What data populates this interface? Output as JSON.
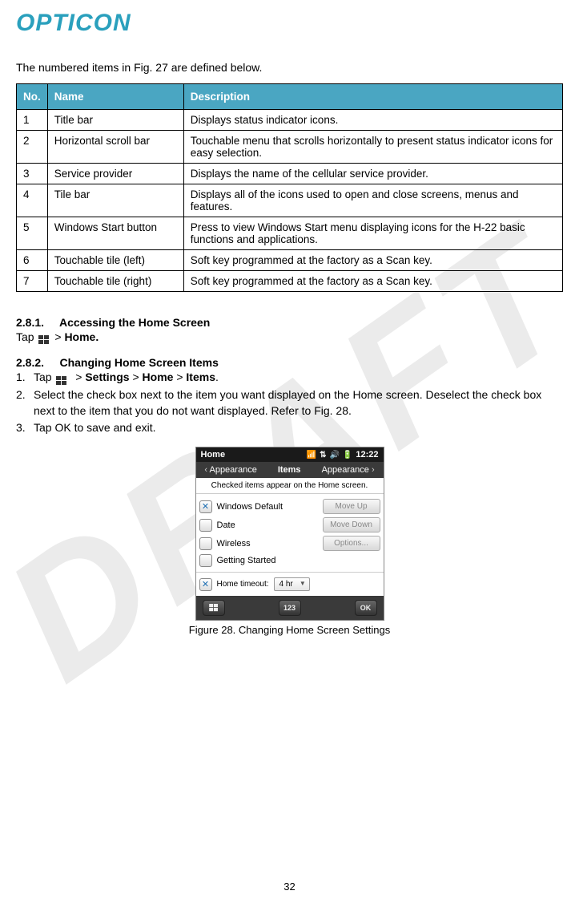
{
  "logo_text": "OPTICON",
  "watermark": "DRAFT",
  "intro": "The numbered items in Fig. 27 are defined below.",
  "table": {
    "headers": {
      "no": "No.",
      "name": "Name",
      "desc": "Description"
    },
    "rows": [
      {
        "no": "1",
        "name": "Title bar",
        "desc": "Displays status indicator icons."
      },
      {
        "no": "2",
        "name": "Horizontal scroll bar",
        "desc": "Touchable menu that scrolls horizontally to present status indicator icons for easy selection."
      },
      {
        "no": "3",
        "name": "Service provider",
        "desc": "Displays the name of the cellular service provider."
      },
      {
        "no": "4",
        "name": "Tile bar",
        "desc": "Displays all of the icons used to open and close screens, menus and features."
      },
      {
        "no": "5",
        "name": "Windows Start button",
        "desc": "Press to view Windows Start menu displaying icons for the H-22 basic functions and applications."
      },
      {
        "no": "6",
        "name": "Touchable tile (left)",
        "desc": "Soft key programmed at the factory as a Scan key."
      },
      {
        "no": "7",
        "name": "Touchable tile (right)",
        "desc": "Soft key programmed at the factory as a Scan key."
      }
    ]
  },
  "section281": {
    "heading_num": "2.8.1.",
    "heading_text": "Accessing the Home Screen",
    "tap_prefix": "Tap ",
    "breadcrumb_gt": " > ",
    "home_bold": "Home."
  },
  "section282": {
    "heading_num": "2.8.2.",
    "heading_text": "Changing Home Screen Items",
    "step1_prefix": "Tap ",
    "step1_settings": "Settings",
    "step1_home": "Home",
    "step1_items": "Items",
    "step1_period": ".",
    "step2": "Select the check box next to the item you want displayed on the Home screen. Deselect the check box next to the item that you do not want displayed. Refer to Fig. 28.",
    "step3": "Tap OK to save and exit.",
    "step_nums": [
      "1.",
      "2.",
      "3."
    ]
  },
  "phone": {
    "title": "Home",
    "time": "12:22",
    "pivot_left": "Appearance",
    "pivot_center": "Items",
    "pivot_right": "Appearance",
    "hint": "Checked items appear on the Home screen.",
    "items": [
      {
        "label": "Windows Default",
        "checked": true
      },
      {
        "label": "Date",
        "checked": false
      },
      {
        "label": "Wireless",
        "checked": false
      },
      {
        "label": "Getting Started",
        "checked": false
      }
    ],
    "buttons": {
      "up": "Move Up",
      "down": "Move Down",
      "options": "Options..."
    },
    "timeout_label": "Home timeout:",
    "timeout_value": "4 hr",
    "bottom": {
      "kb": "123",
      "ok": "OK"
    }
  },
  "figure_caption": "Figure 28. Changing Home Screen Settings",
  "page_number": "32"
}
